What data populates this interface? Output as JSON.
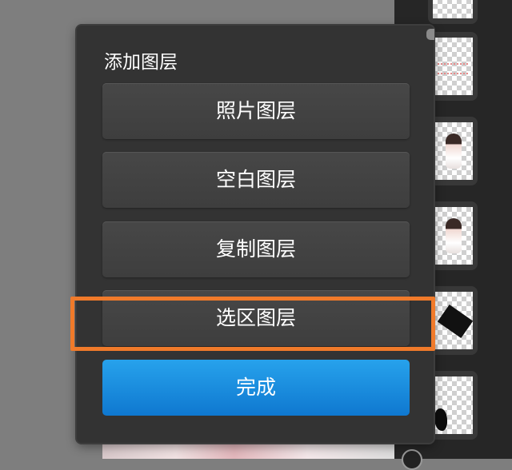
{
  "dialog": {
    "title": "添加图层",
    "options": [
      {
        "label": "照片图层"
      },
      {
        "label": "空白图层"
      },
      {
        "label": "复制图层"
      },
      {
        "label": "选区图层"
      }
    ],
    "done_label": "完成",
    "highlighted_option": "选区图层"
  },
  "layer_strip": {
    "thumbnails": [
      {
        "icon": "transparent-pink-strokes-thumbnail"
      },
      {
        "icon": "portrait-figure-thumbnail"
      },
      {
        "icon": "portrait-figure-thumbnail"
      },
      {
        "icon": "black-shape-thumbnail"
      },
      {
        "icon": "black-splat-thumbnail"
      }
    ]
  },
  "colors": {
    "dialog_background": "#333333",
    "option_button": "#434343",
    "done_button": "#1a8ee0",
    "highlight": "#f07a2a"
  }
}
